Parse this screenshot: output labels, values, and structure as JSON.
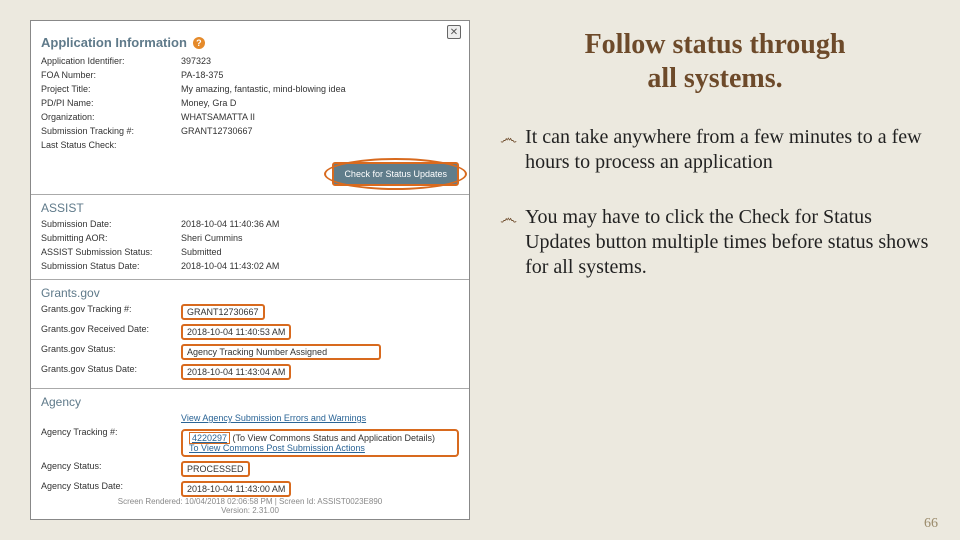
{
  "heading_line1": "Follow status through",
  "heading_line2": "all systems.",
  "bullets": {
    "b1": "It can take anywhere from a few minutes to a few hours to process an application",
    "b2": "You may have to click the Check for Status Updates button multiple times before status shows for all systems."
  },
  "page_number": "66",
  "panel": {
    "close_x": "✕",
    "app_info_title": "Application Information",
    "help_q": "?",
    "fields": {
      "app_identifier_k": "Application Identifier:",
      "app_identifier_v": "397323",
      "foa_k": "FOA Number:",
      "foa_v": "PA-18-375",
      "project_title_k": "Project Title:",
      "project_title_v": "My amazing, fantastic, mind-blowing idea",
      "pdpi_k": "PD/PI Name:",
      "pdpi_v": "Money, Gra D",
      "org_k": "Organization:",
      "org_v": "WHATSAMATTA II",
      "sub_tracking_k": "Submission Tracking #:",
      "sub_tracking_v": "GRANT12730667",
      "last_check_k": "Last Status Check:",
      "last_check_v": ""
    },
    "status_button": "Check for Status Updates",
    "assist_title": "ASSIST",
    "assist": {
      "sub_date_k": "Submission Date:",
      "sub_date_v": "2018-10-04 11:40:36 AM",
      "aor_k": "Submitting AOR:",
      "aor_v": "Sheri Cummins",
      "status_k": "ASSIST Submission Status:",
      "status_v": "Submitted",
      "status_date_k": "Submission Status Date:",
      "status_date_v": "2018-10-04 11:43:02 AM"
    },
    "grantsgov_title": "Grants.gov",
    "grantsgov": {
      "tracking_k": "Grants.gov Tracking #:",
      "tracking_v": "GRANT12730667",
      "received_k": "Grants.gov Received Date:",
      "received_v": "2018-10-04 11:40:53 AM",
      "status_k": "Grants.gov Status:",
      "status_v": "Agency Tracking Number Assigned",
      "status_date_k": "Grants.gov Status Date:",
      "status_date_v": "2018-10-04 11:43:04 AM"
    },
    "agency_title": "Agency",
    "agency": {
      "errors_link": "View Agency Submission Errors and Warnings",
      "tracking_k": "Agency Tracking #:",
      "tracking_v1": "4220297",
      "tracking_link1": " (To View Commons Status and Application Details)",
      "tracking_link2": "To View Commons Post Submission Actions",
      "status_k": "Agency Status:",
      "status_v": "PROCESSED",
      "status_date_k": "Agency Status Date:",
      "status_date_v": "2018-10-04 11:43:00 AM"
    },
    "footer": "Screen Rendered: 10/04/2018 02:06:58 PM | Screen Id: ASSIST0023E890",
    "footer_version": "Version: 2.31.00"
  }
}
